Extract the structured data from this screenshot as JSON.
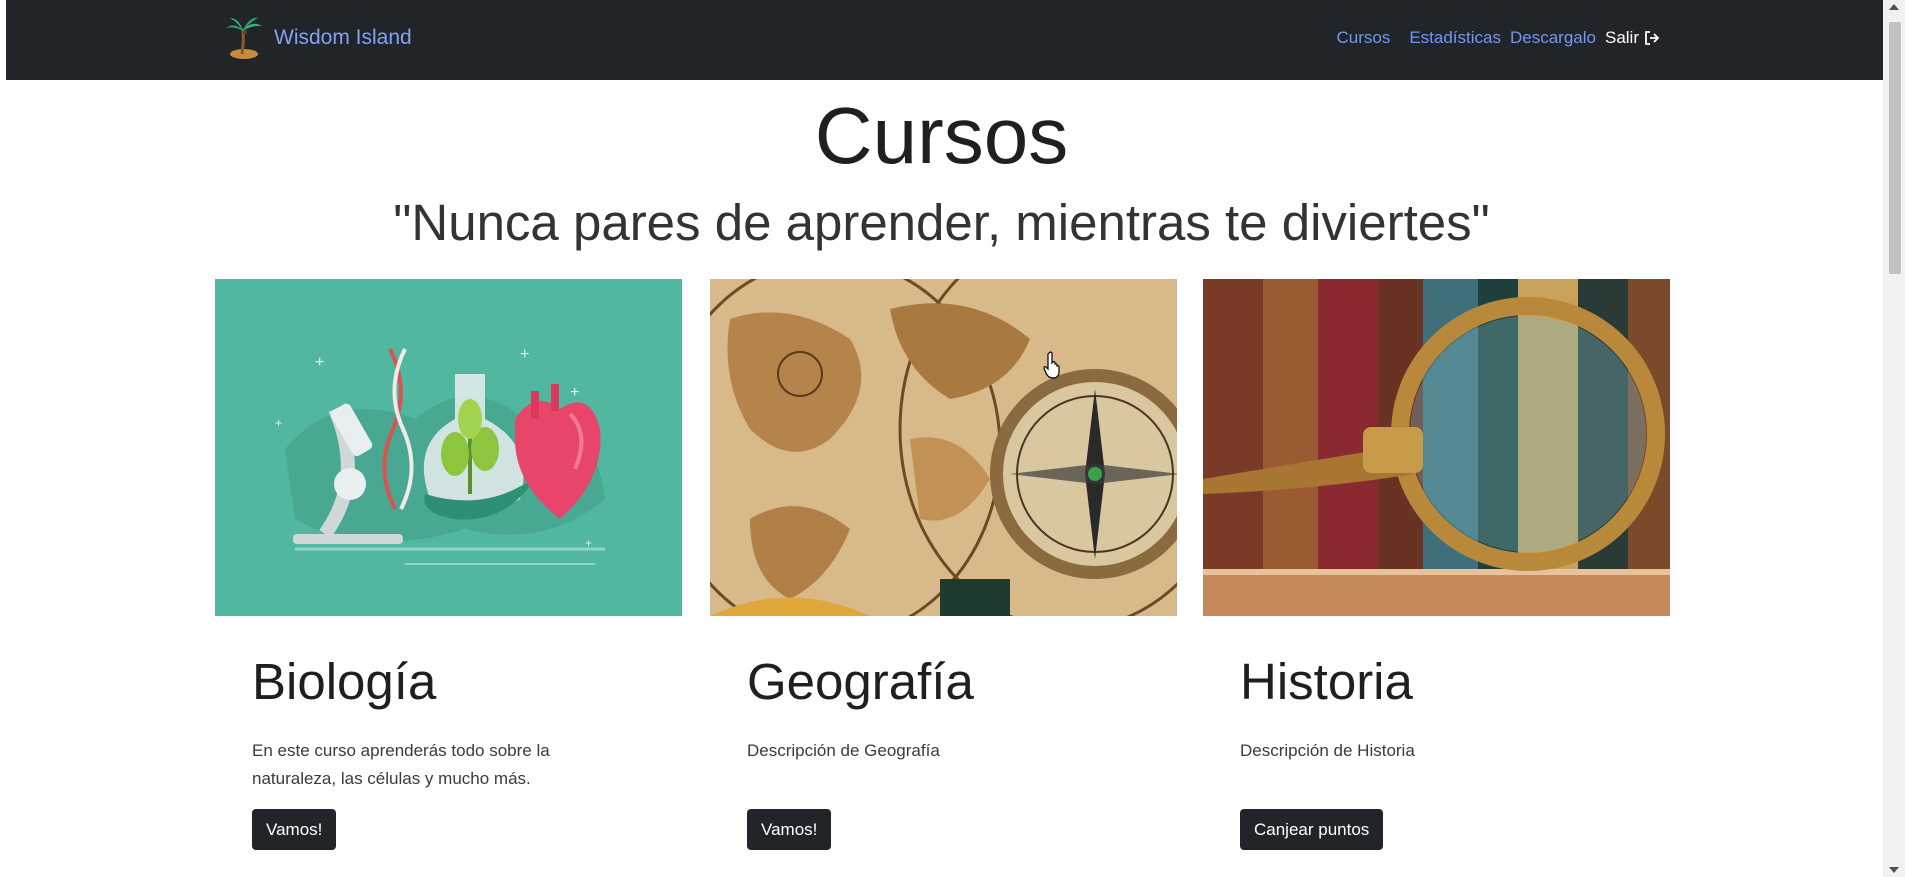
{
  "nav": {
    "brand": "Wisdom Island",
    "links": [
      "Cursos",
      "Estadísticas",
      "Descargalo"
    ],
    "exit_label": "Salir",
    "colors": {
      "bg": "#212529",
      "link": "#6f98f5"
    }
  },
  "header": {
    "title": "Cursos",
    "subtitle": "\"Nunca pares de aprender, mientras te diviertes\""
  },
  "courses": [
    {
      "title": "Biología",
      "description": "En este curso aprenderás todo sobre la naturaleza, las células y mucho más.",
      "button": "Vamos!",
      "image": "biology-illustration"
    },
    {
      "title": "Geografía",
      "description": "Descripción de Geografía",
      "button": "Vamos!",
      "image": "antique-map-compass"
    },
    {
      "title": "Historia",
      "description": "Descripción de Historia",
      "button": "Canjear puntos",
      "image": "old-books-magnifier"
    }
  ]
}
